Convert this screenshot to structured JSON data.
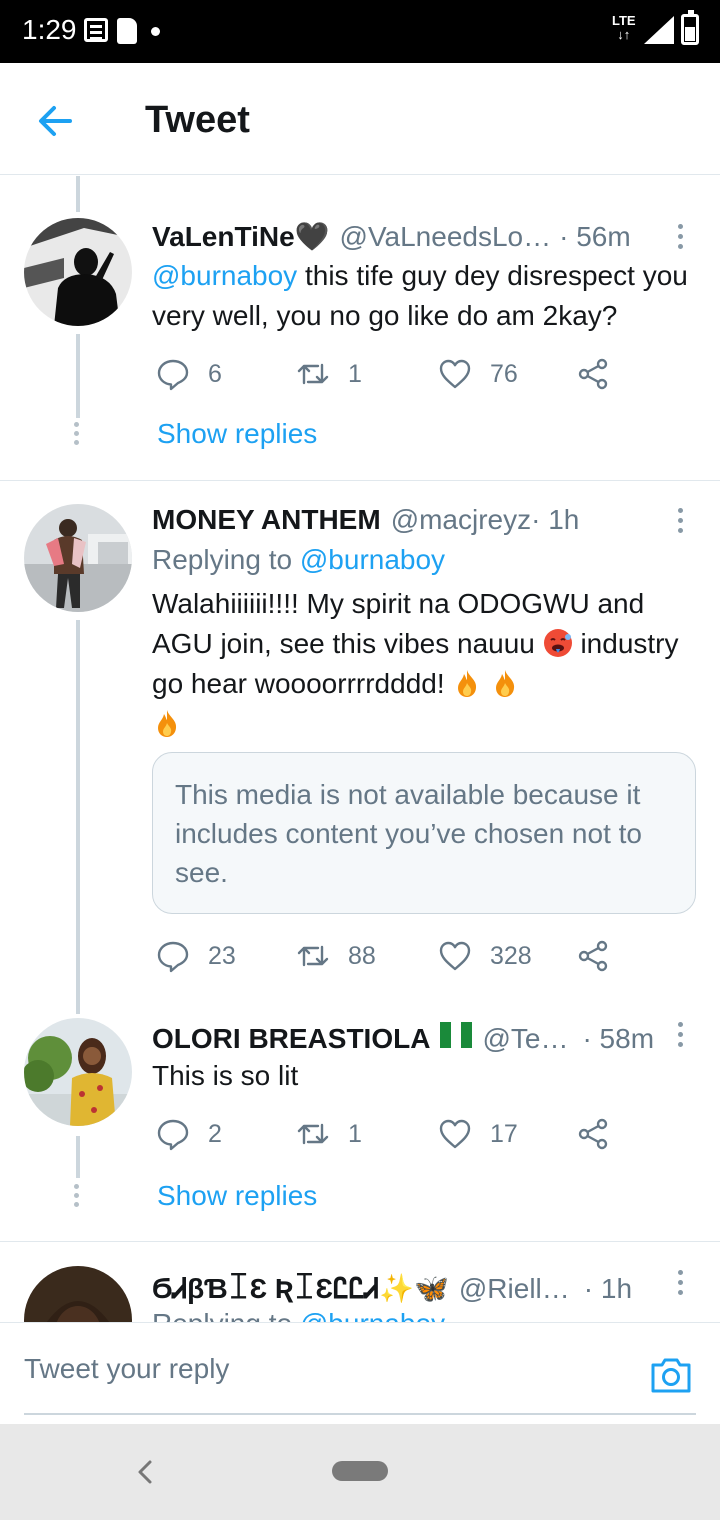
{
  "status_bar": {
    "time": "1:29",
    "network": "LTE"
  },
  "header": {
    "title": "Tweet"
  },
  "colors": {
    "accent": "#1da1f2",
    "secondary_text": "#657786",
    "heart": "#e0245e"
  },
  "tweets": [
    {
      "name": "VaLenTiNe🖤",
      "handle": "@VaLneedsLo…",
      "time": " · 56m",
      "mention": "@burnaboy",
      "text": " this tife guy dey disrespect you very well, you no go like do am 2kay?",
      "replies": "6",
      "retweets": "1",
      "likes": "76",
      "show_replies": "Show replies"
    },
    {
      "name": "MONEY ANTHEM",
      "handle": "@macjreyz",
      "time": " · 1h",
      "replying_prefix": "Replying to ",
      "replying_to": "@burnaboy",
      "text": "Walahiiiiii!!!!  My spirit na ODOGWU and AGU join, see this vibes nauuu ",
      "text2": " industry go hear woooorrrrdddd! ",
      "media_notice": "This media is not available because it includes content you’ve chosen not to see.",
      "replies": "23",
      "retweets": "88",
      "likes": "328"
    },
    {
      "name": "OLORI BREASTIOLA",
      "handle": "@Te…",
      "time": " · 58m",
      "text": "This is so lit",
      "replies": "2",
      "retweets": "1",
      "likes": "17",
      "show_replies": "Show replies"
    },
    {
      "name": "ϬᏗβƁꀤƐ ƦꀤƐᏝᏝᏗ✨🦋",
      "handle": "@Riell…",
      "time": " · 1h",
      "replying_prefix": "Replying to ",
      "replying_to": "@burnaboy"
    }
  ],
  "reply_bar": {
    "placeholder": "Tweet your reply"
  }
}
